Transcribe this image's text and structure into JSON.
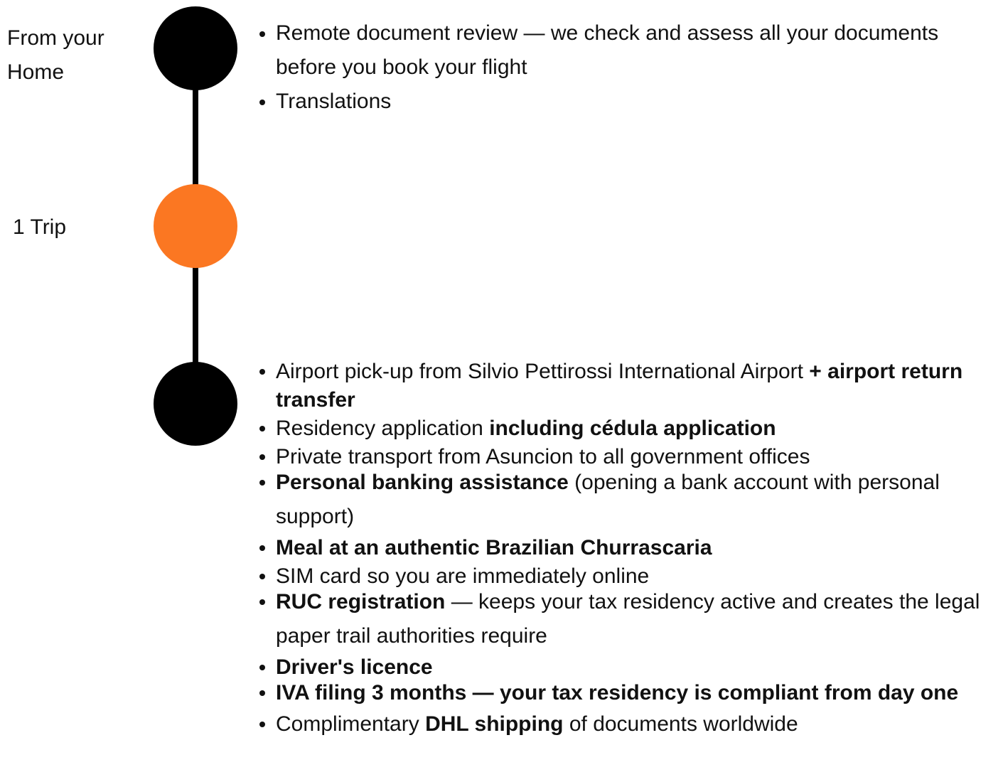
{
  "colors": {
    "node_dark": "#000000",
    "node_accent": "#fb7722",
    "connector": "#000000",
    "text": "#111111"
  },
  "stages": [
    {
      "label": "From your Home",
      "node_color": "#000000"
    },
    {
      "label": "1 Trip",
      "node_color": "#fb7722"
    },
    {
      "label": "",
      "node_color": "#000000"
    }
  ],
  "home_services": [
    "Remote document review — we check and assess all your documents before you book your flight",
    "Translations"
  ],
  "trip_services": [
    {
      "normal": "Airport pick-up from Silvio Pettirossi International Airport ",
      "bold": "+ airport return transfer"
    },
    {
      "normal": "Residency application ",
      "bold": "including cédula application"
    },
    {
      "normal": "Private transport from Asuncion to all government offices"
    },
    {
      "bold": "Personal banking assistance",
      "after": " (opening a bank account with personal support)"
    },
    {
      "bold": "Meal at an authentic Brazilian Churrascaria"
    },
    {
      "normal": "SIM card so you are immediately online"
    },
    {
      "bold": "RUC registration",
      "after": " — keeps your tax residency active and creates the legal paper trail authorities require"
    },
    {
      "bold": "Driver's licence"
    },
    {
      "bold": "IVA filing 3 months — your tax residency is compliant from day one"
    },
    {
      "normal": "Complimentary ",
      "bold": "DHL shipping",
      "after": " of documents worldwide"
    }
  ]
}
